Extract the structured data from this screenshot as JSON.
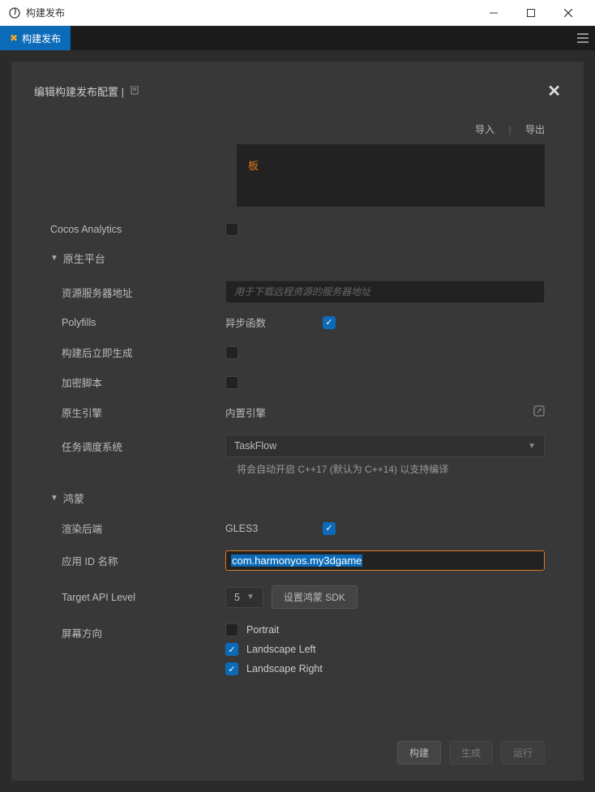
{
  "window": {
    "title": "构建发布"
  },
  "tab": {
    "label": "构建发布"
  },
  "panel": {
    "title": "编辑构建发布配置 |",
    "import": "导入",
    "export": "导出",
    "orange_banner": "板"
  },
  "sections": {
    "analytics_label": "Cocos Analytics",
    "native_platform": "原生平台",
    "harmony": "鸿蒙"
  },
  "native": {
    "resource_server": {
      "label": "资源服务器地址",
      "placeholder": "用于下载远程资源的服务器地址"
    },
    "polyfills": {
      "label": "Polyfills",
      "async_label": "异步函数"
    },
    "build_after": {
      "label": "构建后立即生成"
    },
    "encrypt": {
      "label": "加密脚本"
    },
    "engine": {
      "label": "原生引擎",
      "value": "内置引擎"
    },
    "task_system": {
      "label": "任务调度系统",
      "selected": "TaskFlow",
      "helper": "将会自动开启 C++17 (默认为 C++14)   以支持编译"
    }
  },
  "harmony": {
    "render_backend": {
      "label": "渲染后端",
      "value": "GLES3"
    },
    "app_id": {
      "label": "应用 ID 名称",
      "value": "com.harmonyos.my3dgame"
    },
    "target_api": {
      "label": "Target API Level",
      "value": "5",
      "sdk_btn": "设置鸿蒙 SDK"
    },
    "orientation": {
      "label": "屏幕方向",
      "portrait": "Portrait",
      "landscape_left": "Landscape Left",
      "landscape_right": "Landscape Right"
    }
  },
  "footer": {
    "build": "构建",
    "generate": "生成",
    "run": "运行"
  }
}
